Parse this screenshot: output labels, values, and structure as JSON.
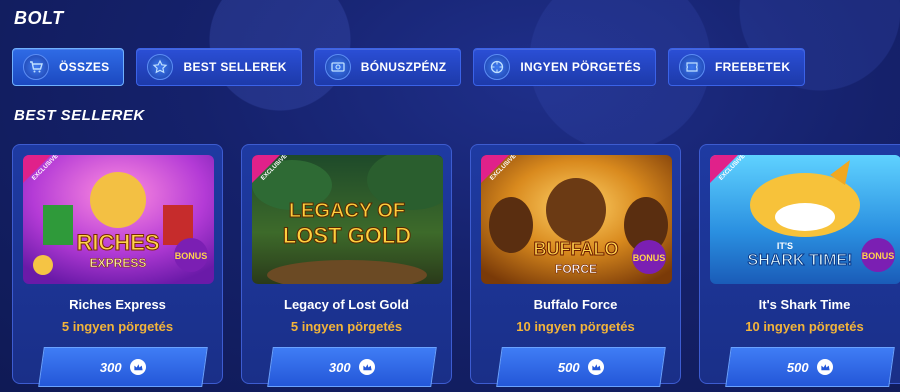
{
  "page": {
    "title": "BOLT"
  },
  "tabs": [
    {
      "label": "ÖSSZES",
      "icon": "cart-icon",
      "active": true
    },
    {
      "label": "BEST SELLEREK",
      "icon": "star-icon",
      "active": false
    },
    {
      "label": "BÓNUSZPÉNZ",
      "icon": "banknote-icon",
      "active": false
    },
    {
      "label": "INGYEN PÖRGETÉS",
      "icon": "spin-icon",
      "active": false
    },
    {
      "label": "FREEBETEK",
      "icon": "ticket-icon",
      "active": false
    }
  ],
  "section": {
    "title": "BEST SELLEREK"
  },
  "cards": [
    {
      "name": "Riches Express",
      "spins": "5 ingyen pörgetés",
      "price": "300",
      "badge": "EXCLUSIVE",
      "art_title": "RICHES",
      "art_subtitle": "EXPRESS",
      "art_bonus": "BONUS"
    },
    {
      "name": "Legacy of Lost Gold",
      "spins": "5 ingyen pörgetés",
      "price": "300",
      "badge": "EXCLUSIVE",
      "art_title": "LEGACY OF",
      "art_subtitle": "LOST GOLD"
    },
    {
      "name": "Buffalo Force",
      "spins": "10 ingyen pörgetés",
      "price": "500",
      "badge": "EXCLUSIVE",
      "art_title": "BUFFALO",
      "art_subtitle": "FORCE",
      "art_bonus": "BONUS"
    },
    {
      "name": "It's Shark Time",
      "spins": "10 ingyen pörgetés",
      "price": "500",
      "badge": "EXCLUSIVE",
      "art_title": "IT'S",
      "art_subtitle": "SHARK TIME!",
      "art_bonus": "BONUS"
    }
  ],
  "colors": {
    "accent": "#f2b43a",
    "badge": "#e0218a",
    "tab_bg": "#2b4fd6"
  }
}
